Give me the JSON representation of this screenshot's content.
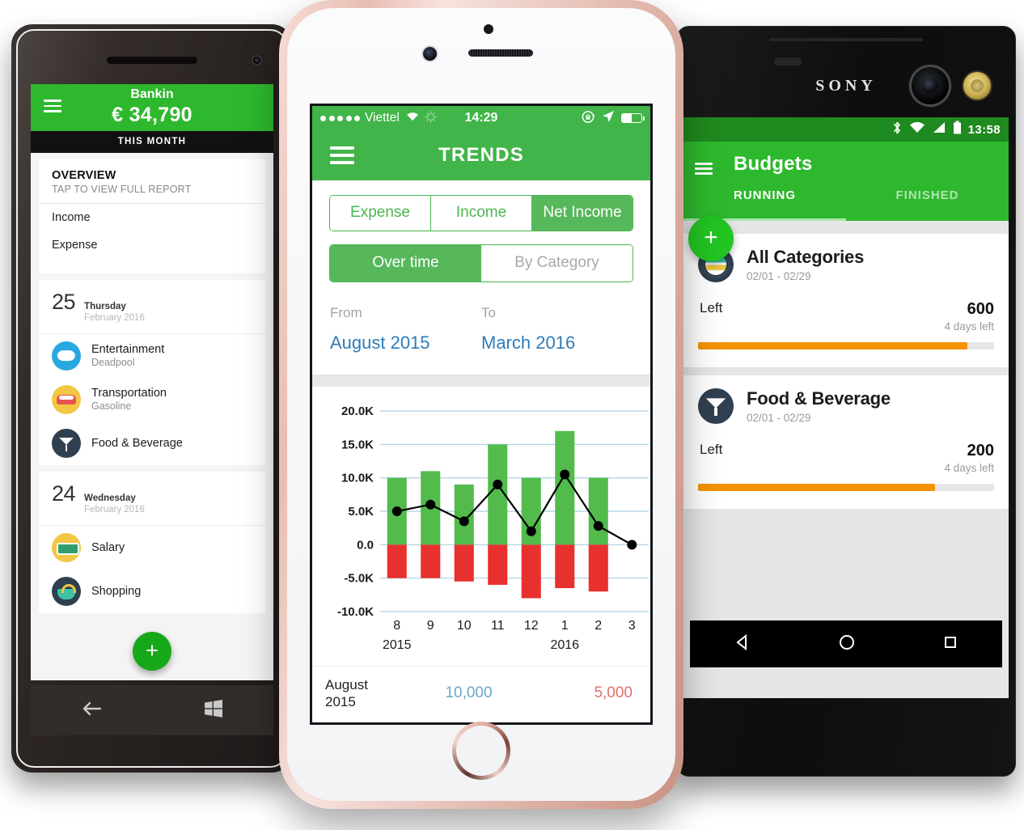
{
  "theme": {
    "brand_green": "#41b549",
    "bar_green": "#52bb4c",
    "bar_red": "#e8302e",
    "link_blue": "#2e7cb8",
    "budget_orange": "#f49300"
  },
  "windows_phone": {
    "status_month": "THIS MONTH",
    "header": {
      "app_name": "Bankin",
      "balance": "€ 34,790",
      "menu_icon": "hamburger-icon"
    },
    "overview": {
      "title": "OVERVIEW",
      "subtitle": "TAP TO VIEW FULL REPORT",
      "rows": [
        "Income",
        "Expense"
      ]
    },
    "days": [
      {
        "day": "25",
        "weekday": "Thursday",
        "month": "February 2016",
        "transactions": [
          {
            "category": "Entertainment",
            "note": "Deadpool",
            "icon": "game-controller-icon"
          },
          {
            "category": "Transportation",
            "note": "Gasoline",
            "icon": "car-icon"
          },
          {
            "category": "Food & Beverage",
            "note": "",
            "icon": "cocktail-icon"
          }
        ]
      },
      {
        "day": "24",
        "weekday": "Wednesday",
        "month": "February 2016",
        "transactions": [
          {
            "category": "Salary",
            "note": "",
            "icon": "money-icon"
          },
          {
            "category": "Shopping",
            "note": "",
            "icon": "basket-icon"
          }
        ]
      }
    ],
    "fab_label": "+",
    "navbar": {
      "back_icon": "back-arrow-icon",
      "home_icon": "windows-logo-icon"
    }
  },
  "iphone": {
    "status": {
      "carrier": "Viettel",
      "signal_dots": 5,
      "wifi_icon": "wifi-icon",
      "sync_icon": "sync-spinner-icon",
      "time": "14:29",
      "lock_icon": "rotation-lock-icon",
      "location_icon": "location-arrow-icon",
      "battery_icon": "battery-icon"
    },
    "appbar": {
      "title": "TRENDS",
      "menu_icon": "hamburger-icon"
    },
    "segment_type": {
      "options": [
        "Expense",
        "Income",
        "Net Income"
      ],
      "selected": "Net Income"
    },
    "segment_view": {
      "options": [
        "Over time",
        "By Category"
      ],
      "selected": "Over time"
    },
    "range": {
      "from_label": "From",
      "from_value": "August 2015",
      "to_label": "To",
      "to_value": "March 2016"
    },
    "summary_row": {
      "month": "August",
      "year": "2015",
      "income": "10,000",
      "expense": "5,000"
    }
  },
  "chart_data": {
    "type": "bar",
    "title": "",
    "xlabel": "",
    "ylabel": "",
    "ylim": [
      -10000,
      20000
    ],
    "yticks": [
      20000,
      15000,
      10000,
      5000,
      0,
      -5000,
      -10000
    ],
    "ytick_labels": [
      "20.0K",
      "15.0K",
      "10.0K",
      "5.0K",
      "0.0",
      "-5.0K",
      "-10.0K"
    ],
    "categories": [
      "8",
      "9",
      "10",
      "11",
      "12",
      "1",
      "2",
      "3"
    ],
    "year_labels": [
      {
        "label": "2015",
        "at_category": "8"
      },
      {
        "label": "2016",
        "at_category": "1"
      }
    ],
    "grid": true,
    "legend": "none",
    "series": [
      {
        "name": "Income",
        "type": "bar",
        "color": "#52bb4c",
        "values": [
          10000,
          11000,
          9000,
          15000,
          10000,
          17000,
          10000,
          0
        ]
      },
      {
        "name": "Expense",
        "type": "bar",
        "color": "#e8302e",
        "values": [
          -5000,
          -5000,
          -5500,
          -6000,
          -8000,
          -6500,
          -7000,
          0
        ]
      },
      {
        "name": "Net Income",
        "type": "line",
        "color": "#000000",
        "values": [
          5000,
          6000,
          3500,
          9000,
          2000,
          10500,
          2800,
          0
        ]
      }
    ]
  },
  "sony_phone": {
    "brand": "SONY",
    "status": {
      "bluetooth_icon": "bluetooth-icon",
      "wifi_icon": "wifi-icon",
      "signal_icon": "signal-icon",
      "battery_icon": "battery-icon",
      "time": "13:58"
    },
    "appbar": {
      "title": "Budgets",
      "menu_icon": "hamburger-icon"
    },
    "tabs": [
      {
        "label": "RUNNING",
        "active": true
      },
      {
        "label": "FINISHED",
        "active": false
      }
    ],
    "fab_label": "+",
    "budgets": [
      {
        "name": "All Categories",
        "range": "02/01 - 02/29",
        "left_label": "Left",
        "amount": "600",
        "days_left": "4 days left",
        "progress_percent": 91,
        "icon": "globe-icon"
      },
      {
        "name": "Food & Beverage",
        "range": "02/01 - 02/29",
        "left_label": "Left",
        "amount": "200",
        "days_left": "4 days left",
        "progress_percent": 80,
        "icon": "cocktail-icon"
      }
    ],
    "navbar": {
      "back_icon": "triangle-back-icon",
      "home_icon": "circle-home-icon",
      "recents_icon": "square-recents-icon"
    }
  }
}
